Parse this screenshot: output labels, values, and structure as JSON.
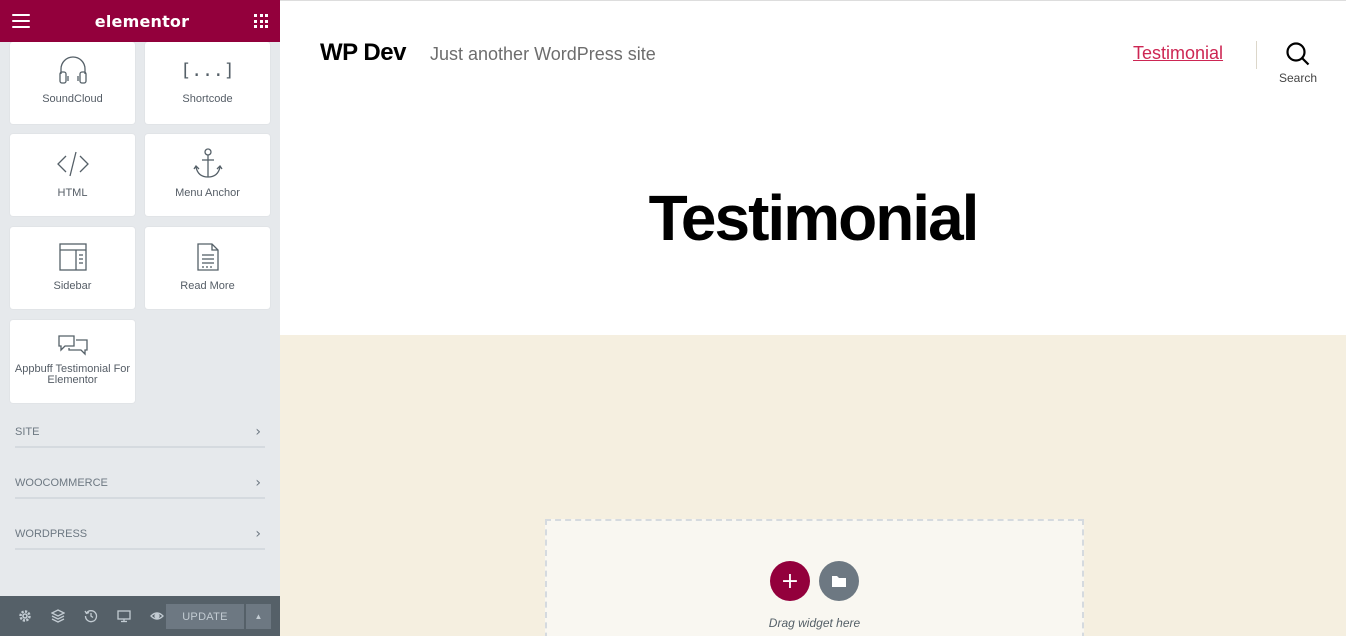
{
  "panel": {
    "brand": "elementor",
    "widgets": [
      {
        "label": "SoundCloud",
        "icon": "headphones-icon"
      },
      {
        "label": "Shortcode",
        "icon": "shortcode-icon"
      },
      {
        "label": "HTML",
        "icon": "code-icon"
      },
      {
        "label": "Menu Anchor",
        "icon": "anchor-icon"
      },
      {
        "label": "Sidebar",
        "icon": "sidebar-icon"
      },
      {
        "label": "Read More",
        "icon": "document-icon"
      },
      {
        "label": "Appbuff Testimonial For Elementor",
        "icon": "chat-bubbles-icon"
      }
    ],
    "shortcode_glyph": "[...]",
    "categories": [
      "SITE",
      "WOOCOMMERCE",
      "WORDPRESS"
    ],
    "footer": {
      "update_label": "UPDATE",
      "icons": [
        "settings-icon",
        "layers-icon",
        "history-icon",
        "responsive-icon",
        "preview-eye-icon"
      ]
    },
    "accent": "#93003c"
  },
  "site": {
    "title": "WP Dev",
    "tagline": "Just another WordPress site",
    "nav": [
      "Testimonial"
    ],
    "search_label": "Search",
    "link_color": "#cd2653"
  },
  "page": {
    "title": "Testimonial",
    "drop_text": "Drag widget here",
    "section_bg": "#f5efe0"
  }
}
